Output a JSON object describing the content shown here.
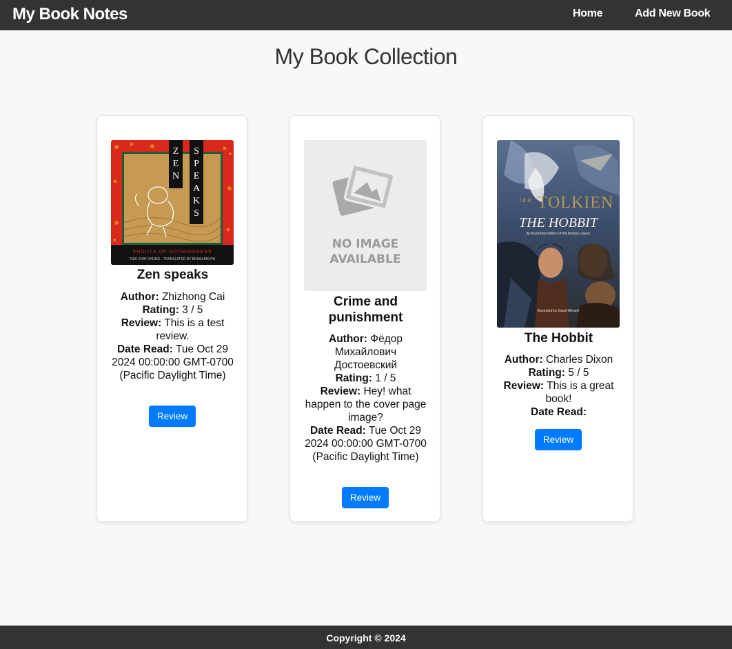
{
  "navbar": {
    "brand": "My Book Notes",
    "links": [
      {
        "label": "Home"
      },
      {
        "label": "Add New Book"
      }
    ]
  },
  "page": {
    "title": "My Book Collection"
  },
  "books": [
    {
      "title": "Zen speaks",
      "cover": "zen-speaks-cover",
      "author_label": "Author:",
      "author": "Zhizhong Cai",
      "rating_label": "Rating:",
      "rating": "3 / 5",
      "review_label": "Review:",
      "review": "This is a test review.",
      "date_label": "Date Read:",
      "date_read": "Tue Oct 29 2024 00:00:00 GMT-0700 (Pacific Daylight Time)",
      "button_label": "Review",
      "cover_text": {
        "word1": "ZEN",
        "word2": "SPEAKS",
        "subtitle": "SHOUTS OF NOTHINGNESS",
        "credits": "TSAI CHIH CHUNG · TRANSLATED BY BRIAN BRUYA"
      }
    },
    {
      "title": "Crime and punishment",
      "cover": "no-image-placeholder",
      "author_label": "Author:",
      "author": "Фёдор Михайлович Достоевский",
      "rating_label": "Rating:",
      "rating": "1 / 5",
      "review_label": "Review:",
      "review": "Hey! what happen to the cover page image?",
      "date_label": "Date Read:",
      "date_read": "Tue Oct 29 2024 00:00:00 GMT-0700 (Pacific Daylight Time)",
      "button_label": "Review",
      "cover_text": {
        "line1": "NO IMAGE",
        "line2": "AVAILABLE"
      }
    },
    {
      "title": "The Hobbit",
      "cover": "the-hobbit-cover",
      "author_label": "Author:",
      "author": "Charles Dixon",
      "rating_label": "Rating:",
      "rating": "5 / 5",
      "review_label": "Review:",
      "review": "This is a great book!",
      "date_label": "Date Read:",
      "date_read": "",
      "button_label": "Review",
      "cover_text": {
        "author": "TOLKIEN",
        "initials": "J.R.R.",
        "title": "THE HOBBIT",
        "tagline": "An illustrated edition of the fantasy classic",
        "illustrator": "Illustrated by David Wenzel"
      }
    }
  ],
  "footer": {
    "text": "Copyright © 2024"
  },
  "colors": {
    "navbar": "#333333",
    "background": "#f8f8f8",
    "button": "#007bff"
  }
}
